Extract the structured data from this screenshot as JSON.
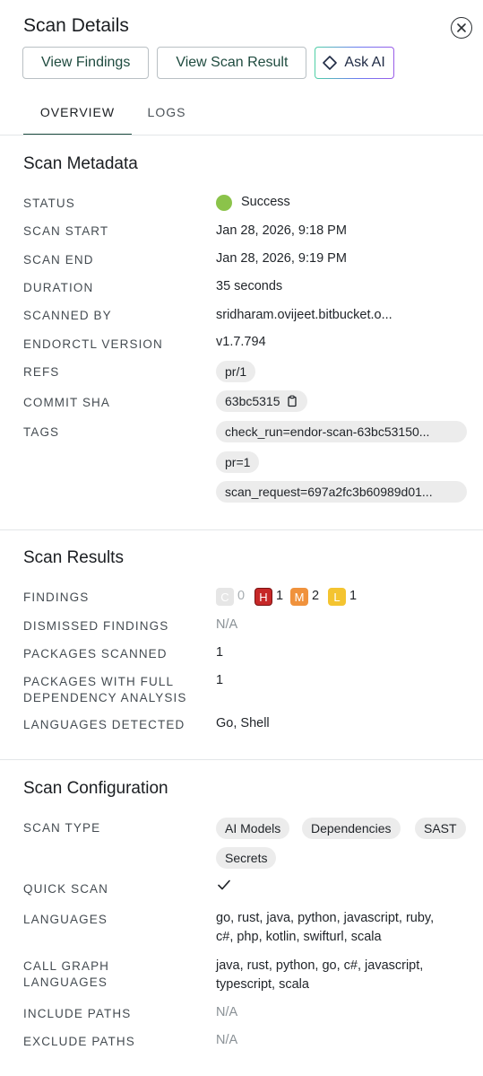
{
  "header": {
    "title": "Scan Details"
  },
  "actions": {
    "view_findings": "View Findings",
    "view_scan_result": "View Scan Result",
    "ask_ai": "Ask AI"
  },
  "tabs": [
    {
      "label": "OVERVIEW",
      "active": true
    },
    {
      "label": "LOGS",
      "active": false
    }
  ],
  "metadata": {
    "title": "Scan Metadata",
    "status": {
      "label": "STATUS",
      "value": "Success",
      "color": "#8bc34a"
    },
    "scan_start": {
      "label": "SCAN START",
      "value": "Jan 28, 2026, 9:18 PM"
    },
    "scan_end": {
      "label": "SCAN END",
      "value": "Jan 28, 2026, 9:19 PM"
    },
    "duration": {
      "label": "DURATION",
      "value": "35 seconds"
    },
    "scanned_by": {
      "label": "SCANNED BY",
      "value": "sridharam.ovijeet.bitbucket.o..."
    },
    "endorctl_version": {
      "label": "ENDORCTL VERSION",
      "value": "v1.7.794"
    },
    "refs": {
      "label": "REFS",
      "values": [
        "pr/1"
      ]
    },
    "commit_sha": {
      "label": "COMMIT SHA",
      "value": "63bc5315"
    },
    "tags": {
      "label": "TAGS",
      "values": [
        "check_run=endor-scan-63bc53150...",
        "pr=1",
        "scan_request=697a2fc3b60989d01..."
      ]
    }
  },
  "results": {
    "title": "Scan Results",
    "findings": {
      "label": "FINDINGS",
      "critical": {
        "letter": "C",
        "count": "0"
      },
      "high": {
        "letter": "H",
        "count": "1"
      },
      "medium": {
        "letter": "M",
        "count": "2"
      },
      "low": {
        "letter": "L",
        "count": "1"
      }
    },
    "dismissed_findings": {
      "label": "DISMISSED FINDINGS",
      "value": "N/A"
    },
    "packages_scanned": {
      "label": "PACKAGES SCANNED",
      "value": "1"
    },
    "packages_full_dep": {
      "label_line1": "PACKAGES WITH FULL",
      "label_line2": "DEPENDENCY ANALYSIS",
      "value": "1"
    },
    "languages_detected": {
      "label": "LANGUAGES DETECTED",
      "value": "Go, Shell"
    }
  },
  "configuration": {
    "title": "Scan Configuration",
    "scan_type": {
      "label": "SCAN TYPE",
      "values": [
        "AI Models",
        "Dependencies",
        "SAST",
        "Secrets"
      ]
    },
    "quick_scan": {
      "label": "QUICK SCAN",
      "enabled": true
    },
    "languages": {
      "label": "LANGUAGES",
      "line1": "go, rust, java, python, javascript, ruby,",
      "line2": "c#, php, kotlin, swifturl, scala"
    },
    "call_graph_languages": {
      "label_line1": "CALL GRAPH",
      "label_line2": "LANGUAGES",
      "line1": "java, rust, python, go, c#, javascript,",
      "line2": "typescript, scala"
    },
    "include_paths": {
      "label": "INCLUDE PATHS",
      "value": "N/A"
    },
    "exclude_paths": {
      "label": "EXCLUDE PATHS",
      "value": "N/A"
    }
  }
}
